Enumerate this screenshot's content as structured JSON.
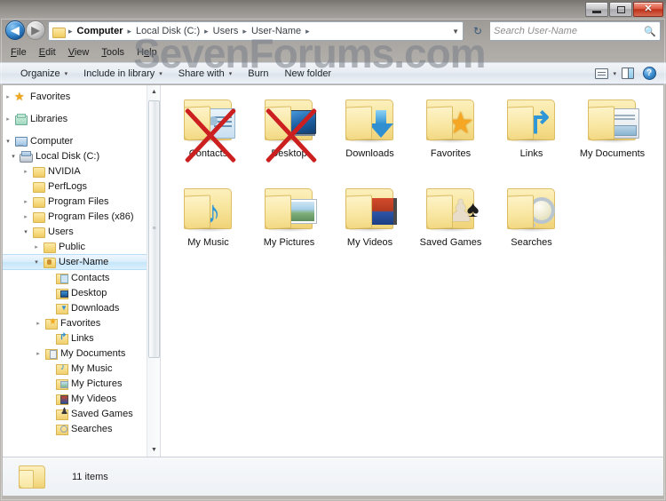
{
  "window": {
    "controls": {
      "minimize": "–",
      "maximize": "□",
      "close": "✕"
    }
  },
  "address_bar": {
    "back_arrow": "◀",
    "forward_arrow": "▶",
    "history_caret": "▼",
    "folder_icon_name": "folder-icon",
    "crumbs": [
      "Computer",
      "Local Disk (C:)",
      "Users",
      "User-Name"
    ],
    "separator": "▸",
    "dropdown_caret": "▼",
    "refresh_glyph": "↻"
  },
  "search": {
    "placeholder": "Search User-Name",
    "icon": "🔍"
  },
  "menu_bar": {
    "items": [
      {
        "label": "File",
        "accel": "F"
      },
      {
        "label": "Edit",
        "accel": "E"
      },
      {
        "label": "View",
        "accel": "V"
      },
      {
        "label": "Tools",
        "accel": "T"
      },
      {
        "label": "Help",
        "accel": "H"
      }
    ]
  },
  "command_bar": {
    "organize": "Organize",
    "include_in_library": "Include in library",
    "share_with": "Share with",
    "burn": "Burn",
    "new_folder": "New folder",
    "caret": "▾",
    "help_glyph": "?"
  },
  "watermark": {
    "text": "SevenForums.com",
    "color": "#787e86"
  },
  "nav_pane": {
    "items": [
      {
        "label": "Favorites",
        "twisty": "▸",
        "icon": "f-star",
        "indent": 6,
        "selected": false,
        "gap_after": true
      },
      {
        "label": "Libraries",
        "twisty": "▸",
        "icon": "f-lib",
        "indent": 6,
        "selected": false,
        "gap_after": true
      },
      {
        "label": "Computer",
        "twisty": "▾",
        "icon": "f-pc",
        "indent": 6,
        "selected": false
      },
      {
        "label": "Local Disk (C:)",
        "twisty": "▾",
        "icon": "f-disk",
        "indent": 18,
        "selected": false
      },
      {
        "label": "NVIDIA",
        "twisty": "▸",
        "icon": "f-folder",
        "indent": 32,
        "selected": false
      },
      {
        "label": "PerfLogs",
        "twisty": "",
        "icon": "f-folder",
        "indent": 32,
        "selected": false
      },
      {
        "label": "Program Files",
        "twisty": "▸",
        "icon": "f-folder",
        "indent": 32,
        "selected": false
      },
      {
        "label": "Program Files (x86)",
        "twisty": "▸",
        "icon": "f-folder",
        "indent": 32,
        "selected": false
      },
      {
        "label": "Users",
        "twisty": "▾",
        "icon": "f-folder",
        "indent": 32,
        "selected": false
      },
      {
        "label": "Public",
        "twisty": "▸",
        "icon": "f-folder",
        "indent": 44,
        "selected": false
      },
      {
        "label": "User-Name",
        "twisty": "▾",
        "icon": "f-user",
        "indent": 44,
        "selected": true
      },
      {
        "label": "Contacts",
        "twisty": "",
        "icon": "f-contacts",
        "indent": 58,
        "selected": false
      },
      {
        "label": "Desktop",
        "twisty": "",
        "icon": "f-desktop",
        "indent": 58,
        "selected": false
      },
      {
        "label": "Downloads",
        "twisty": "",
        "icon": "f-dl",
        "indent": 58,
        "selected": false
      },
      {
        "label": "Favorites",
        "twisty": "▸",
        "icon": "f-fav",
        "indent": 46,
        "selected": false
      },
      {
        "label": "Links",
        "twisty": "",
        "icon": "f-links",
        "indent": 58,
        "selected": false
      },
      {
        "label": "My Documents",
        "twisty": "▸",
        "icon": "f-docs",
        "indent": 46,
        "selected": false
      },
      {
        "label": "My Music",
        "twisty": "",
        "icon": "f-music",
        "indent": 58,
        "selected": false
      },
      {
        "label": "My Pictures",
        "twisty": "",
        "icon": "f-pics",
        "indent": 58,
        "selected": false
      },
      {
        "label": "My Videos",
        "twisty": "",
        "icon": "f-vids",
        "indent": 58,
        "selected": false
      },
      {
        "label": "Saved Games",
        "twisty": "",
        "icon": "f-games",
        "indent": 58,
        "selected": false
      },
      {
        "label": "Searches",
        "twisty": "",
        "icon": "f-search",
        "indent": 58,
        "selected": false
      }
    ],
    "scrollbar": {
      "up_arrow": "▲",
      "down_arrow": "▼",
      "grip": "≡"
    }
  },
  "content": {
    "items": [
      {
        "label": "Contacts",
        "overlay": "ov-contacts",
        "overlay_name": "contacts-card-icon",
        "crossed_out": true
      },
      {
        "label": "Desktop",
        "overlay": "ov-desktop",
        "overlay_name": "monitor-icon",
        "crossed_out": true
      },
      {
        "label": "Downloads",
        "overlay": "ov-download",
        "overlay_name": "down-arrow-icon",
        "crossed_out": false
      },
      {
        "label": "Favorites",
        "overlay": "ov-star",
        "overlay_name": "star-icon",
        "crossed_out": false,
        "glyph": "★"
      },
      {
        "label": "Links",
        "overlay": "ov-link",
        "overlay_name": "link-arrow-icon",
        "crossed_out": false,
        "glyph": "↱"
      },
      {
        "label": "My Documents",
        "overlay": "ov-doc",
        "overlay_name": "document-icon",
        "crossed_out": false
      },
      {
        "label": "My Music",
        "overlay": "ov-music",
        "overlay_name": "music-note-icon",
        "crossed_out": false,
        "glyph": "♪"
      },
      {
        "label": "My Pictures",
        "overlay": "ov-pic",
        "overlay_name": "photo-icon",
        "crossed_out": false
      },
      {
        "label": "My Videos",
        "overlay": "ov-vid",
        "overlay_name": "film-strip-icon",
        "crossed_out": false
      },
      {
        "label": "Saved Games",
        "overlay": "ov-games",
        "overlay_name": "chess-pawn-icon",
        "crossed_out": false
      },
      {
        "label": "Searches",
        "overlay": "ov-srch",
        "overlay_name": "magnifier-icon",
        "crossed_out": false
      }
    ]
  },
  "status_bar": {
    "text": "11 items"
  }
}
